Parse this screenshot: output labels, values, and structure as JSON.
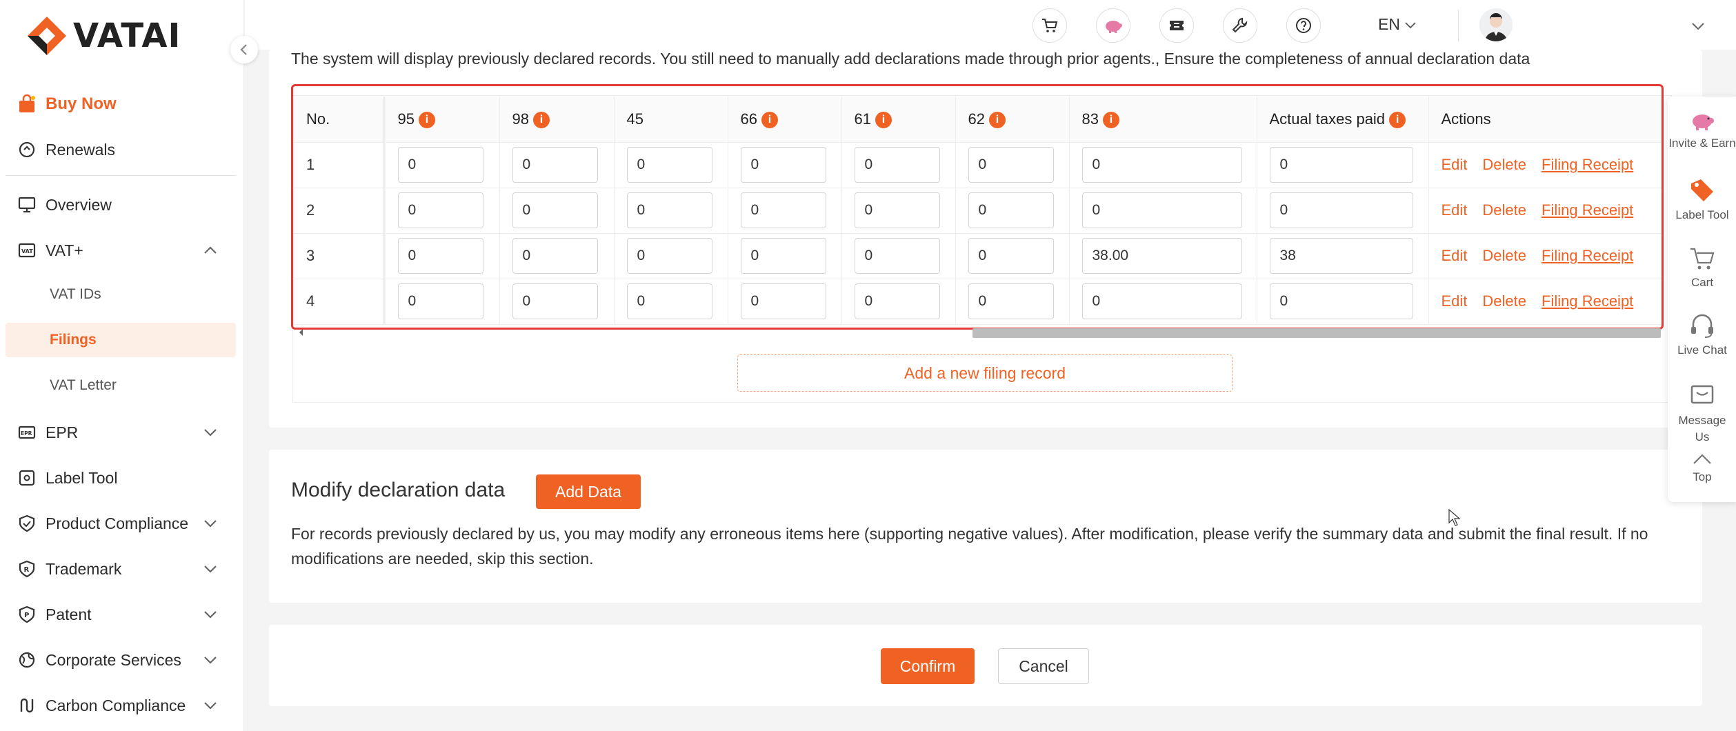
{
  "brand": {
    "name": "VATAI",
    "accent": "#f06223"
  },
  "sidebar": {
    "items": [
      {
        "label": "Buy Now",
        "icon": "shopping-bag-icon"
      },
      {
        "label": "Renewals",
        "icon": "renew-icon"
      },
      {
        "label": "Overview",
        "icon": "monitor-icon"
      },
      {
        "label": "VAT+",
        "icon": "vat-icon"
      },
      {
        "label": "VAT IDs"
      },
      {
        "label": "Filings"
      },
      {
        "label": "VAT Letter"
      },
      {
        "label": "EPR",
        "icon": "epr-icon"
      },
      {
        "label": "Label Tool",
        "icon": "label-icon"
      },
      {
        "label": "Product Compliance",
        "icon": "shield-icon"
      },
      {
        "label": "Trademark",
        "icon": "trademark-icon"
      },
      {
        "label": "Patent",
        "icon": "patent-icon"
      },
      {
        "label": "Corporate Services",
        "icon": "globe-icon"
      },
      {
        "label": "Carbon Compliance",
        "icon": "carbon-icon"
      }
    ]
  },
  "header": {
    "icons": [
      "cart-icon",
      "pig-icon",
      "ticket-icon",
      "tools-icon",
      "help-icon"
    ],
    "language": "EN"
  },
  "main": {
    "intro_text": "The system will display previously declared records. You still need to manually add declarations made through prior agents.,   Ensure the completeness of annual declaration data",
    "table": {
      "columns": [
        "No.",
        "95",
        "98",
        "45",
        "66",
        "61",
        "62",
        "83",
        "Actual taxes paid",
        "Actions"
      ],
      "rows": [
        {
          "no": "1",
          "c95": "0",
          "c98": "0",
          "c45": "0",
          "c66": "0",
          "c61": "0",
          "c62": "0",
          "c83": "0",
          "paid": "0"
        },
        {
          "no": "2",
          "c95": "0",
          "c98": "0",
          "c45": "0",
          "c66": "0",
          "c61": "0",
          "c62": "0",
          "c83": "0",
          "paid": "0"
        },
        {
          "no": "3",
          "c95": "0",
          "c98": "0",
          "c45": "0",
          "c66": "0",
          "c61": "0",
          "c62": "0",
          "c83": "38.00",
          "paid": "38"
        },
        {
          "no": "4",
          "c95": "0",
          "c98": "0",
          "c45": "0",
          "c66": "0",
          "c61": "0",
          "c62": "0",
          "c83": "0",
          "paid": "0"
        }
      ],
      "actions": {
        "edit": "Edit",
        "delete": "Delete",
        "receipt": "Filing Receipt"
      }
    },
    "add_record_label": "Add a new filing record",
    "modify": {
      "title": "Modify declaration data",
      "add_button": "Add Data",
      "description": "For records previously declared by us, you may modify any erroneous items here (supporting negative values). After modification, please verify the summary data and submit the final result. If no modifications are needed, skip this section."
    },
    "confirm_label": "Confirm",
    "cancel_label": "Cancel"
  },
  "float_panel": {
    "items": [
      {
        "label": "Invite & Earn",
        "icon": "pig-icon"
      },
      {
        "label": "Label Tool",
        "icon": "tag-icon"
      },
      {
        "label": "Cart",
        "icon": "cart-icon"
      },
      {
        "label": "Live Chat",
        "icon": "headset-icon"
      },
      {
        "label": "Message Us",
        "icon": "message-icon"
      },
      {
        "label": "Top",
        "icon": "arrow-up-icon"
      }
    ]
  }
}
